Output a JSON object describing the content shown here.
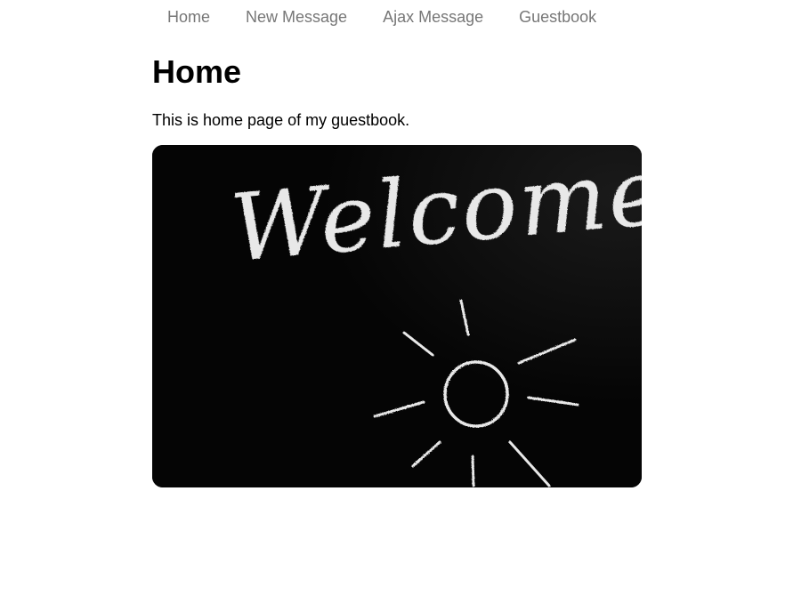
{
  "nav": {
    "items": [
      {
        "label": "Home"
      },
      {
        "label": "New Message"
      },
      {
        "label": "Ajax Message"
      },
      {
        "label": "Guestbook"
      }
    ]
  },
  "main": {
    "title": "Home",
    "intro": "This is home page of my guestbook.",
    "image": {
      "text": "Welcome"
    }
  },
  "colors": {
    "nav_link": "#777777",
    "text": "#000000",
    "chalkboard": "#050505",
    "chalk": "#e8e8e8"
  }
}
